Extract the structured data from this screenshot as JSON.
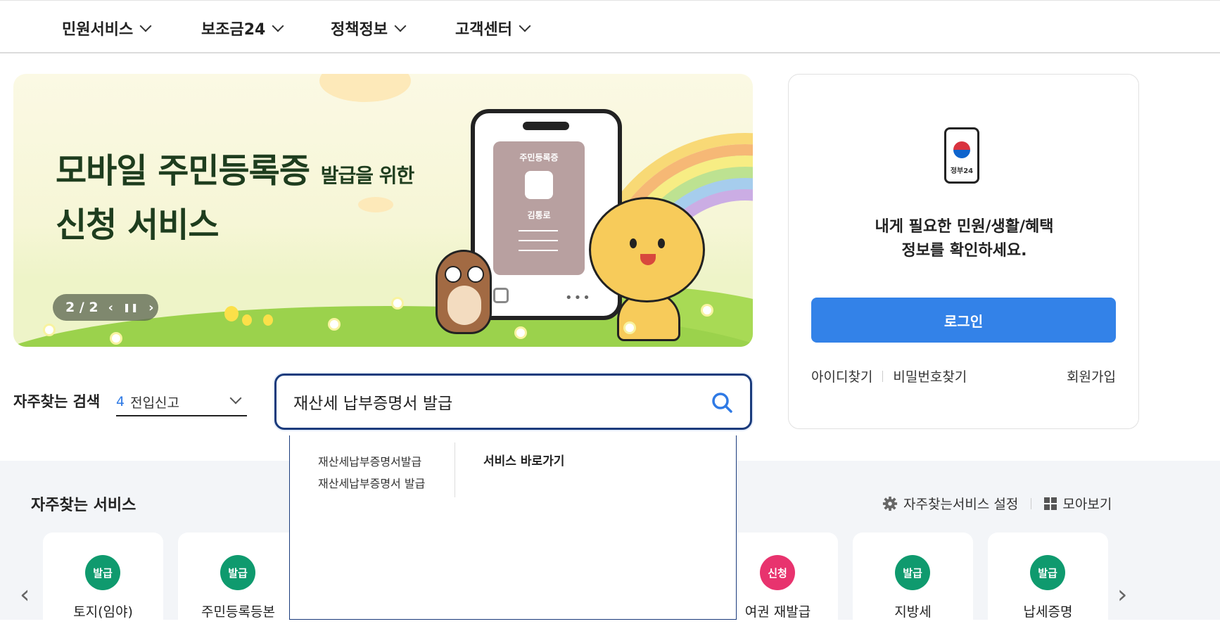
{
  "nav": {
    "items": [
      {
        "label": "민원서비스"
      },
      {
        "label": "보조금24"
      },
      {
        "label": "정책정보"
      },
      {
        "label": "고객센터"
      }
    ]
  },
  "banner": {
    "title_line1_big": "모바일 주민등록증",
    "title_line1_small": "발급을 위한",
    "title_line2": "신청 서비스",
    "card_label": "주민등록증",
    "card_name": "김통로",
    "pager": "2 / 2"
  },
  "login": {
    "icon_text": "정부24",
    "message_line1": "내게 필요한 민원/생활/혜택",
    "message_line2": "정보를 확인하세요.",
    "button": "로그인",
    "find_id": "아이디찾기",
    "find_pw": "비밀번호찾기",
    "join": "회원가입"
  },
  "search": {
    "fav_label": "자주찾는 검색",
    "fav_rank": "4",
    "fav_term": "전입신고",
    "value": "재산세 납부증명서 발급"
  },
  "autocomplete": {
    "suggestions": [
      "재산세납부증명서발급",
      "재산세납부증명서 발급"
    ],
    "go_label": "서비스 바로가기"
  },
  "services": {
    "title": "자주찾는 서비스",
    "setting_label": "자주찾는서비스 설정",
    "view_all_label": "모아보기",
    "cards": [
      {
        "badge": "발급",
        "name": "토지(임야)",
        "color": "#0f9a6e"
      },
      {
        "badge": "발급",
        "name": "주민등록등본",
        "color": "#0f9a6e"
      },
      {
        "badge": "신청",
        "name": "여권 재발급",
        "color": "#e8336e"
      },
      {
        "badge": "발급",
        "name": "지방세",
        "color": "#0f9a6e"
      },
      {
        "badge": "발급",
        "name": "납세증명",
        "color": "#0f9a6e"
      }
    ]
  },
  "colors": {
    "accent": "#3382e8",
    "search_border": "#1a3b7c",
    "issue_badge": "#0f9a6e",
    "apply_badge": "#e8336e"
  }
}
